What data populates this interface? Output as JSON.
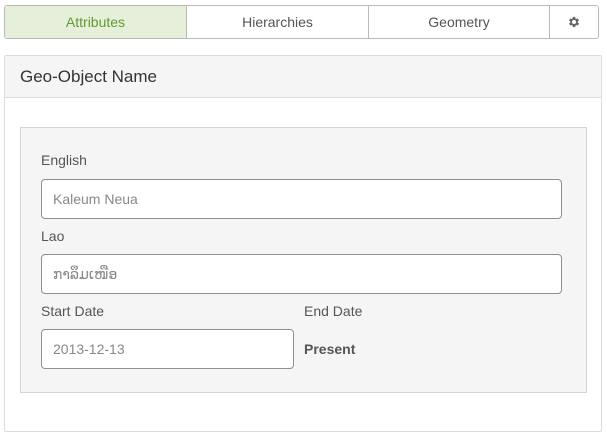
{
  "tabs": [
    {
      "label": "Attributes",
      "active": true
    },
    {
      "label": "Hierarchies",
      "active": false
    },
    {
      "label": "Geometry",
      "active": false
    },
    {
      "icon": "gear-icon"
    }
  ],
  "panel": {
    "title": "Geo-Object Name",
    "fields": {
      "english": {
        "label": "English",
        "value": "Kaleum Neua"
      },
      "lao": {
        "label": "Lao",
        "value": "ກາລຶມເໜືອ"
      },
      "start_date": {
        "label": "Start Date",
        "value": "2013-12-13"
      },
      "end_date": {
        "label": "End Date",
        "value": "Present"
      }
    }
  },
  "colors": {
    "active_tab_bg": "#e6efd9",
    "active_tab_text": "#5f9b2e"
  }
}
